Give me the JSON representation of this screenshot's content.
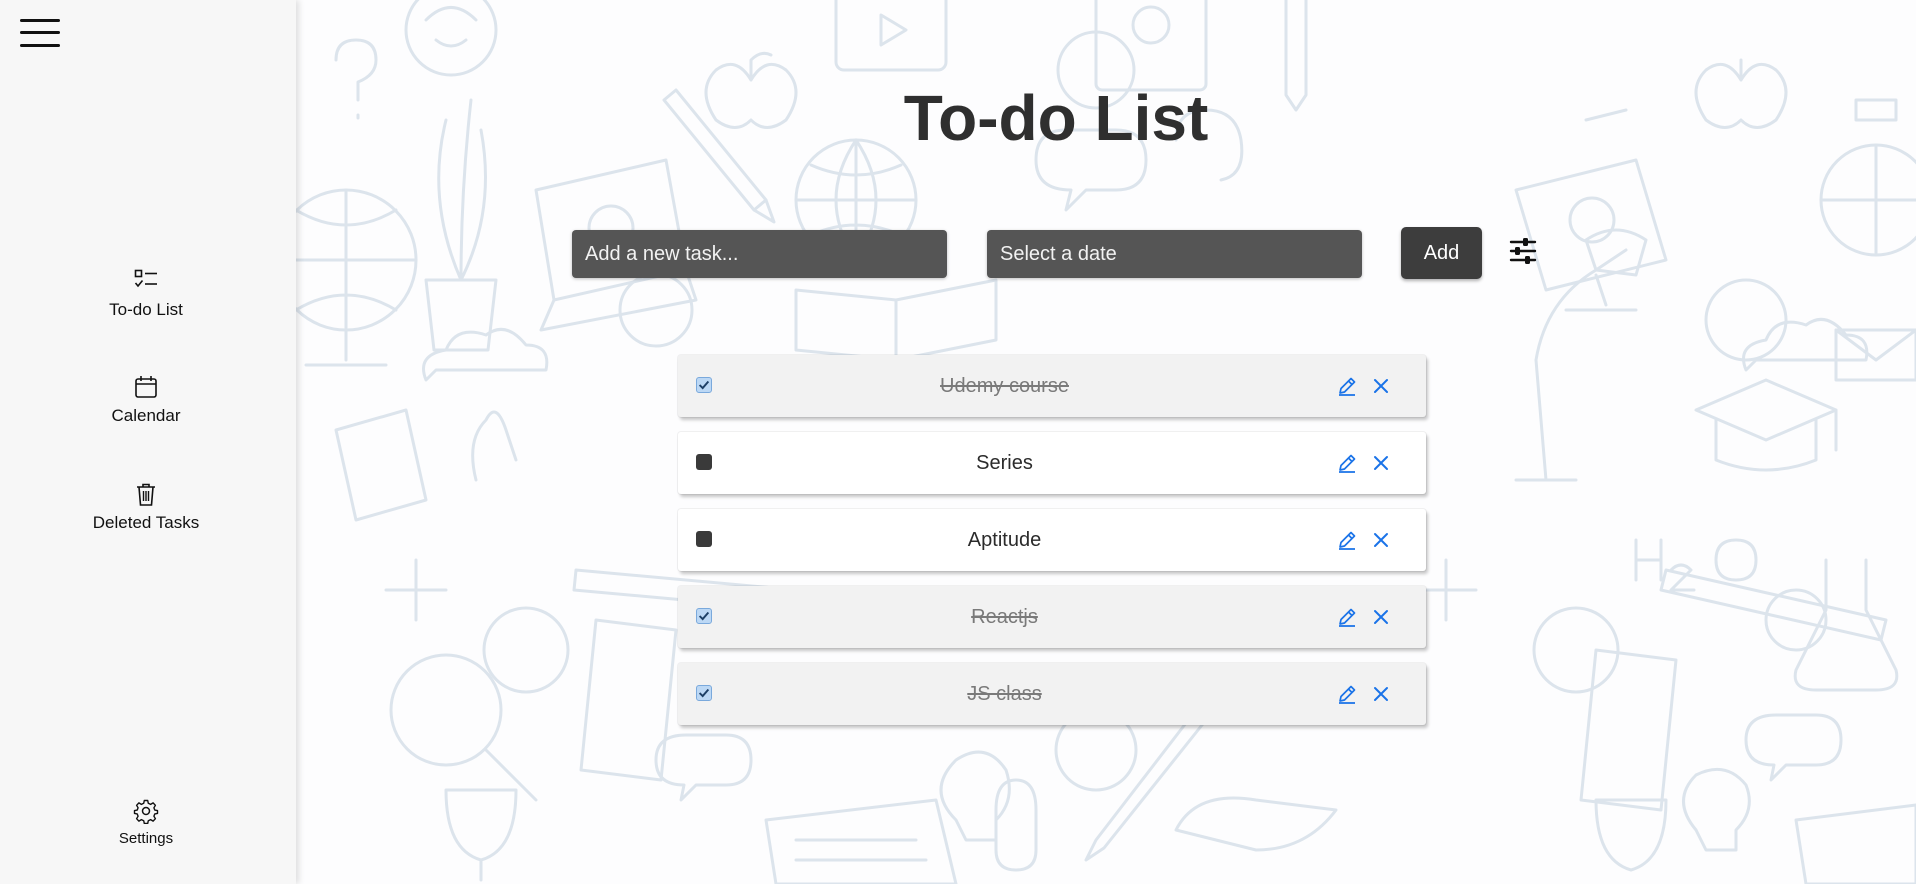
{
  "sidebar": {
    "menu_icon": "hamburger-icon",
    "items": [
      {
        "label": "To-do List",
        "icon": "checklist-icon"
      },
      {
        "label": "Calendar",
        "icon": "calendar-icon"
      },
      {
        "label": "Deleted Tasks",
        "icon": "trash-icon"
      }
    ],
    "settings": {
      "label": "Settings",
      "icon": "gear-icon"
    }
  },
  "main": {
    "title": "To-do List",
    "task_input": {
      "placeholder": "Add a new task...",
      "value": ""
    },
    "date_input": {
      "placeholder": "Select a date",
      "value": ""
    },
    "add_label": "Add",
    "filter_icon": "sliders-icon",
    "tasks": [
      {
        "text": "Udemy course",
        "completed": true
      },
      {
        "text": "Series",
        "completed": false
      },
      {
        "text": "Aptitude",
        "completed": false
      },
      {
        "text": "Reactjs",
        "completed": true
      },
      {
        "text": "JS class",
        "completed": true
      }
    ]
  },
  "colors": {
    "sidebar_bg": "#f7f7f7",
    "input_bg": "#555555",
    "button_bg": "#3d3d3d",
    "action_icon": "#1a73e8",
    "doodle_stroke": "#dce4ec"
  }
}
